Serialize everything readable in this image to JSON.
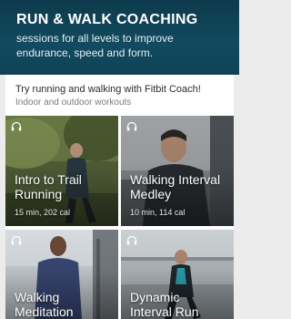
{
  "header": {
    "title": "RUN & WALK COACHING",
    "subtitle_lines": [
      "sessions for all levels to improve",
      "endurance, speed and form."
    ]
  },
  "promo": {
    "headline": "Try running and walking with Fitbit Coach!",
    "subtext": "Indoor and outdoor workouts"
  },
  "workouts": [
    {
      "title_lines": [
        "Intro to Trail",
        "Running"
      ],
      "meta": "15 min, 202 cal",
      "icon": "headphones-icon"
    },
    {
      "title_lines": [
        "Walking Interval",
        "Medley"
      ],
      "meta": "10 min, 114 cal",
      "icon": "headphones-icon"
    },
    {
      "title_lines": [
        "Walking",
        "Meditation"
      ],
      "meta": "",
      "icon": "headphones-icon"
    },
    {
      "title_lines": [
        "Dynamic",
        "Interval Run"
      ],
      "meta": "",
      "icon": "headphones-icon"
    }
  ],
  "colors": {
    "header_bg": "#124a5f",
    "card_text": "#ffffff",
    "page_bg": "#ececec"
  }
}
